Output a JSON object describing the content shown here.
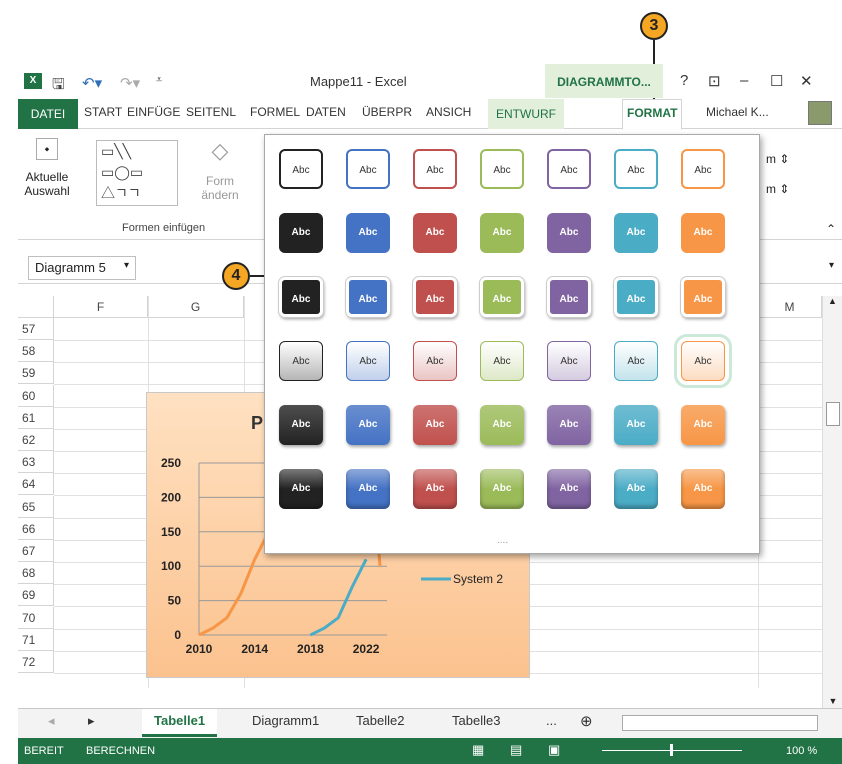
{
  "window": {
    "title": "Mappe11 - Excel",
    "context_tab": "DIAGRAMMTO...",
    "help": "?",
    "user": "Michael K..."
  },
  "tabs": [
    "DATEI",
    "START",
    "EINFÜGE",
    "SEITENL",
    "FORMEL",
    "DATEN",
    "ÜBERPR",
    "ANSICH",
    "ENTWURF",
    "FORMAT"
  ],
  "ribbon": {
    "aktuelle_auswahl_1": "Aktuelle",
    "aktuelle_auswahl_2": "Auswahl",
    "form_aendern_1": "Form",
    "form_aendern_2": "ändern",
    "group_formen": "Formen einfügen"
  },
  "namebox": "Diagramm 5",
  "columns": [
    "F",
    "G",
    "M"
  ],
  "rows": [
    "57",
    "58",
    "59",
    "60",
    "61",
    "62",
    "63",
    "64",
    "65",
    "66",
    "67",
    "68",
    "69",
    "70",
    "71",
    "72"
  ],
  "gallery": {
    "swatch_label": "Abc",
    "more": "....",
    "colors": [
      "#222222",
      "#4472c4",
      "#c0504d",
      "#9bbb59",
      "#8064a2",
      "#4bacc6",
      "#f79646"
    ],
    "rows": [
      {
        "style": "outline"
      },
      {
        "style": "fill"
      },
      {
        "style": "fill-border"
      },
      {
        "style": "light-gradient"
      },
      {
        "style": "gradient"
      },
      {
        "style": "glossy"
      }
    ],
    "selected": {
      "row": 3,
      "col": 6
    }
  },
  "chart_data": {
    "type": "line",
    "title": "P",
    "x": [
      2010,
      2014,
      2018,
      2022
    ],
    "xticks": [
      "2010",
      "2014",
      "2018",
      "2022"
    ],
    "yticks": [
      "0",
      "50",
      "100",
      "150",
      "200",
      "250"
    ],
    "ylim": [
      0,
      250
    ],
    "series": [
      {
        "name": "",
        "color": "#f79646",
        "points": [
          [
            2010,
            0
          ],
          [
            2011,
            10
          ],
          [
            2012,
            25
          ],
          [
            2013,
            60
          ],
          [
            2014,
            110
          ],
          [
            2015,
            150
          ]
        ]
      },
      {
        "name": "System 2",
        "color": "#4bacc6",
        "points": [
          [
            2018,
            0
          ],
          [
            2019,
            10
          ],
          [
            2020,
            25
          ],
          [
            2021,
            70
          ],
          [
            2022,
            110
          ]
        ]
      }
    ],
    "tail_point": [
      2023,
      100
    ]
  },
  "callouts": [
    "3",
    "4"
  ],
  "sheets": {
    "nav_prev": "◂",
    "nav_next": "▸",
    "tabs": [
      "Tabelle1",
      "Diagramm1",
      "Tabelle2",
      "Tabelle3"
    ],
    "more": "...",
    "add": "⊕"
  },
  "status": {
    "ready": "BEREIT",
    "calc": "BERECHNEN",
    "zoom": "100 %"
  }
}
